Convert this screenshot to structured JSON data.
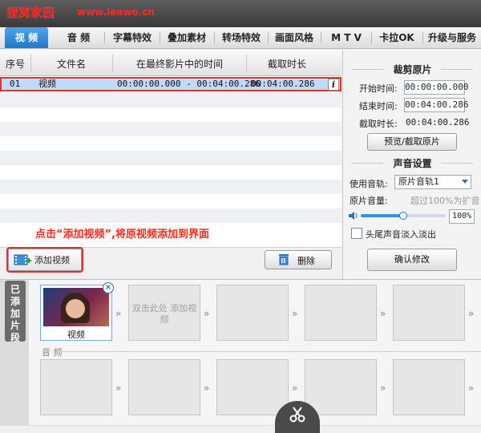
{
  "watermark": {
    "site_name": "狸窝家园",
    "url": "www.leawo.cn"
  },
  "tabs": [
    {
      "label": "视 频",
      "active": true
    },
    {
      "label": "音 频"
    },
    {
      "label": "字幕特效"
    },
    {
      "label": "叠加素材"
    },
    {
      "label": "转场特效"
    },
    {
      "label": "画面风格"
    },
    {
      "label": "M T V"
    },
    {
      "label": "卡拉OK"
    },
    {
      "label": "升级与服务"
    }
  ],
  "video_list": {
    "columns": [
      "序号",
      "文件名",
      "在最终影片中的时间",
      "截取时长"
    ],
    "rows": [
      {
        "index": "01",
        "name": "视频",
        "time_range": "00:00:00.000 - 00:04:00.286",
        "duration": "00:04:00.286"
      }
    ]
  },
  "annotation": "点击“添加视频”,将原视频添加到界面",
  "actions": {
    "add_video": "添加视频",
    "delete": "删除"
  },
  "crop_panel": {
    "title": "裁剪原片",
    "start_label": "开始时间:",
    "start_value": "00:00:00.000",
    "end_label": "结束时间:",
    "end_value": "00:04:00.286",
    "duration_label": "截取时长:",
    "duration_value": "00:04:00.286",
    "preview_button": "预览/截取原片"
  },
  "audio_panel": {
    "title": "声音设置",
    "track_label": "使用音轨:",
    "track_value": "原片音轨1",
    "volume_label": "原片音量:",
    "volume_hint": "超过100%为扩音",
    "volume_value": "100%",
    "volume_fraction": 0.5,
    "fade_label": "头尾声音淡入淡出",
    "confirm_button": "确认修改"
  },
  "timeline": {
    "tab_label": "已添加片段",
    "clip_name": "视频",
    "empty_slot_text": "双击此处 添加视频",
    "audio_label": "音 频"
  }
}
